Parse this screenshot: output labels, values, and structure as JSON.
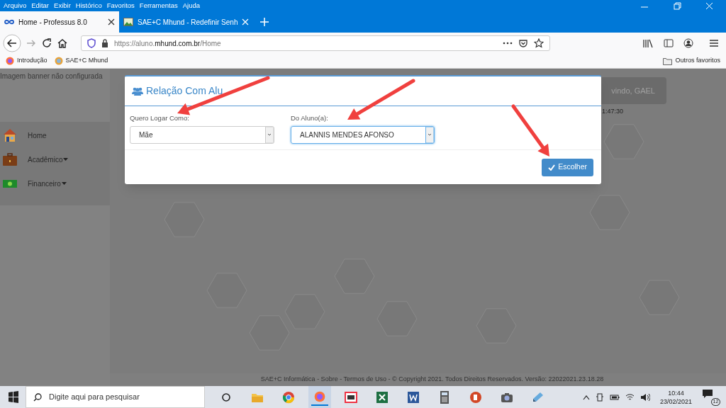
{
  "browser": {
    "menu": [
      "Arquivo",
      "Editar",
      "Exibir",
      "Histórico",
      "Favoritos",
      "Ferramentas",
      "Ajuda"
    ],
    "tabs": [
      {
        "title": "Home - Professus 8.0",
        "selected": true
      },
      {
        "title": "SAE+C Mhund - Redefinir Senh",
        "selected": false
      }
    ],
    "url": {
      "prefix": "https://aluno.",
      "domain": "mhund.com.br",
      "path": "/Home"
    },
    "bookmarks": [
      "Introdução",
      "SAE+C Mhund"
    ],
    "other_bookmarks": "Outros favoritos"
  },
  "page": {
    "banner": "Imagem banner não configurada",
    "sidebar": [
      {
        "label": "Home",
        "dropdown": false
      },
      {
        "label": "Acadêmico",
        "dropdown": true
      },
      {
        "label": "Financeiro",
        "dropdown": true
      }
    ],
    "welcome": "vindo, GAEL",
    "time": "1:47:30",
    "footer": "SAE+C Informática - Sobre - Termos de Uso - © Copyright 2021. Todos Direitos Reservados. Versão: 22022021.23.18.28"
  },
  "modal": {
    "title": "Relação Com Alu",
    "fields": [
      {
        "label": "Quero Logar Como:",
        "value": "Mãe",
        "focused": false
      },
      {
        "label": "Do Aluno(a):",
        "value": "ALANNIS MENDES AFONSO",
        "focused": true
      }
    ],
    "button": "Escolher"
  },
  "taskbar": {
    "search_placeholder": "Digite aqui para pesquisar",
    "time": "10:44",
    "date": "23/02/2021",
    "notifications": "12"
  }
}
